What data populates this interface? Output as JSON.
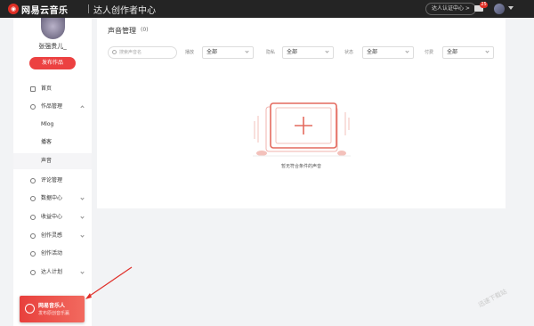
{
  "topbar": {
    "logo_glyph": "◉",
    "brand": "网易云音乐",
    "subbrand": "达人创作者中心",
    "creator_center_btn": "达人认证中心 >",
    "mail_badge": "25"
  },
  "sidebar": {
    "profile_name": "张强贵儿_",
    "publish_btn": "发布作品",
    "items": [
      {
        "label": "首页"
      },
      {
        "label": "作品管理"
      },
      {
        "label": "Mlog"
      },
      {
        "label": "播客"
      },
      {
        "label": "声音"
      },
      {
        "label": "评论管理"
      },
      {
        "label": "数据中心"
      },
      {
        "label": "收益中心"
      },
      {
        "label": "创作灵感"
      },
      {
        "label": "创作活动"
      },
      {
        "label": "达人计划"
      }
    ],
    "promo": {
      "title": "网易音乐人",
      "subtitle": "发布原创音乐赢"
    }
  },
  "main": {
    "title": "声音管理",
    "count": "(0)",
    "search_placeholder": "搜索声音名",
    "filters": [
      {
        "label": "播放",
        "value": "全部"
      },
      {
        "label": "隐私",
        "value": "全部"
      },
      {
        "label": "状态",
        "value": "全部"
      },
      {
        "label": "付费",
        "value": "全部"
      }
    ],
    "empty_text": "暂无符合条件的声音"
  },
  "watermark": "迅速下载站",
  "colors": {
    "accent": "#ec4141",
    "topbar": "#242424",
    "background": "#f2f3f5"
  }
}
